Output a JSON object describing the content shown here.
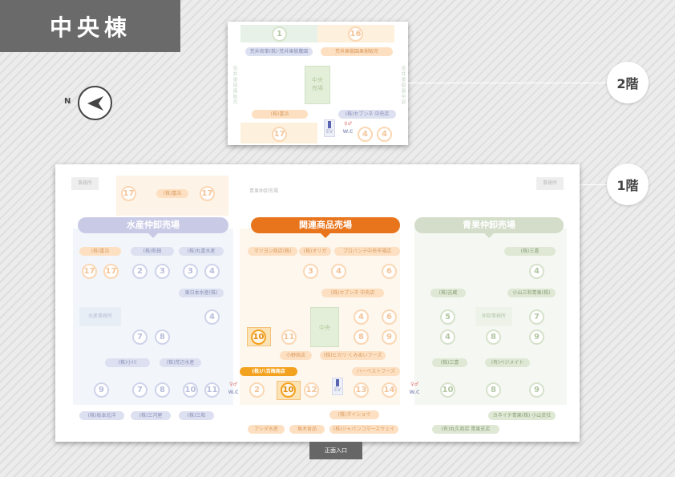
{
  "building_title": "中央棟",
  "compass": {
    "letter": "N",
    "icon": "north-arrow-icon"
  },
  "floor_labels": {
    "floor2": "2階",
    "floor1": "1階"
  },
  "entrance_label": "正面入口",
  "floor2": {
    "numbers": {
      "top_left": "1",
      "top_right": "16",
      "bottom_left": "17",
      "bottom_right_a": "4",
      "bottom_right_b": "4"
    },
    "pills": {
      "top_left": "荒井商事(株)·荒井果樹農園",
      "top_right": "荒井果樹園果樹販売",
      "bottom_left": "(株)富浜",
      "bottom_right": "(株)セブンネ 中央店"
    },
    "center_block": "中央\n売場",
    "side_left": "荒井果樹園販売",
    "side_right": "荒井果樹園中卸",
    "ev": "EV",
    "wc": "W.C"
  },
  "floor1": {
    "top_labels": {
      "left_box": "事務所",
      "right_box": "事務所",
      "middle": "青果仲卸売場"
    },
    "top_pill": "(株)富浜",
    "top_numbers": [
      "17",
      "17"
    ],
    "sections": {
      "left": "水産仲卸売場",
      "center": "関連商品売場",
      "right": "青果仲卸売場"
    },
    "left_pills": [
      "(株)富浜",
      "(株)和田",
      "(株)丸喜水産",
      "東日本水産(株)",
      "(株)小川",
      "(株)荒辺水産",
      "(株)坂本北洋",
      "(株)三河屋",
      "(株)三和"
    ],
    "left_numbers": [
      "17",
      "17",
      "2",
      "3",
      "3",
      "4",
      "4",
      "7",
      "8",
      "7",
      "8",
      "9",
      "10",
      "11"
    ],
    "center_pills": [
      "マツヨン商店(株)",
      "(株)オリガ",
      "プロバンテ中央市場店",
      "(株)セブンネ 中央店",
      "小野商店",
      "(株)ヒカリ·くみあいフーズ",
      "ハーベストフーズ",
      "(株)ダイショウ",
      "アシダ水産",
      "魚木食品",
      "(株)ジャパンコマースウェイ"
    ],
    "center_numbers": [
      "3",
      "4",
      "6",
      "4",
      "6",
      "11",
      "8",
      "9",
      "2",
      "12",
      "13",
      "14"
    ],
    "center_block": "中央",
    "highlight": {
      "label": "(株)八百梅商店",
      "number": "10"
    },
    "right_pills": [
      "(株)三喜",
      "(株)吉蔵",
      "小山三和青果(株)",
      "(株)三喜",
      "(有)ベジメイト",
      "カネイチ青果(株) 小山支社",
      "(有)丸久商店 青果支店"
    ],
    "right_numbers": [
      "4",
      "5",
      "7",
      "4",
      "8",
      "9",
      "10",
      "8",
      "9"
    ],
    "right_office": "仲卸事務所",
    "left_office": "水産事務所",
    "ev": "EV",
    "wc": "W.C"
  },
  "colors": {
    "accent_orange": "#e8741c",
    "highlight": "#f3a21f",
    "title_bg": "#6a6a6a"
  }
}
